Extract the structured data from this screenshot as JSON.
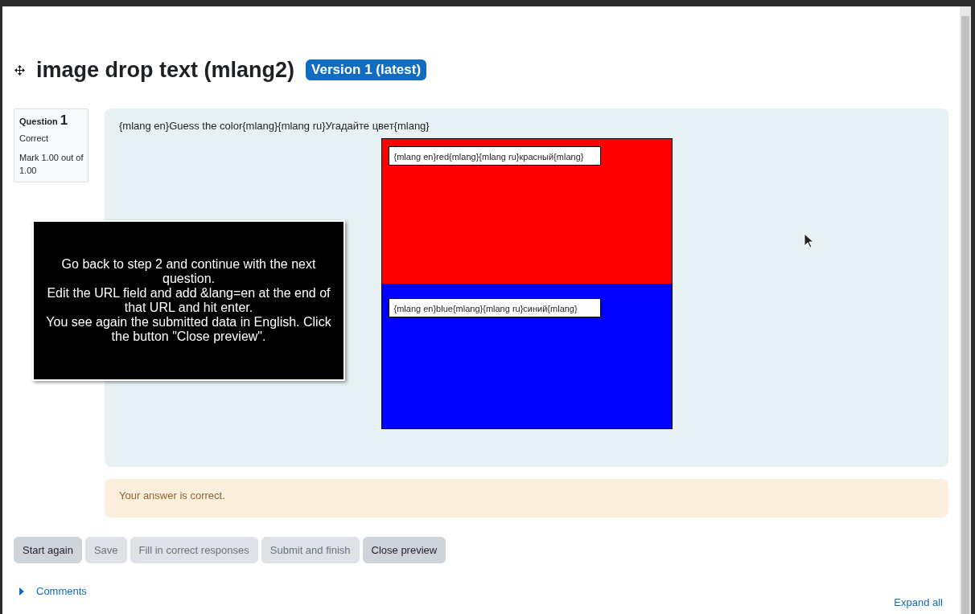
{
  "page": {
    "title": "image drop text (mlang2)",
    "badge": "Version 1 (latest)"
  },
  "question_info": {
    "label": "Question",
    "number": "1",
    "state": "Correct",
    "mark": "Mark 1.00 out of 1.00"
  },
  "question": {
    "text": "{mlang en}Guess the color{mlang}{mlang ru}Угадайте цвет{mlang}",
    "drops": [
      {
        "text": "{mlang en}red{mlang}{mlang ru}красный{mlang}"
      },
      {
        "text": "{mlang en}blue{mlang}{mlang ru}синий{mlang}"
      }
    ]
  },
  "feedback": "Your answer is correct.",
  "buttons": [
    {
      "label": "Start again",
      "disabled": false
    },
    {
      "label": "Save",
      "disabled": true
    },
    {
      "label": "Fill in correct responses",
      "disabled": true
    },
    {
      "label": "Submit and finish",
      "disabled": true
    },
    {
      "label": "Close preview",
      "disabled": false
    }
  ],
  "comments_link": "Comments",
  "expand_all": "Expand all",
  "tooltip": {
    "lines": [
      "Go back to step 2 and continue with the next question.",
      "Edit the URL field and add &lang=en at the end of that URL and hit enter.",
      "You see again the submitted data in English. Click the button \"Close preview\"."
    ]
  }
}
